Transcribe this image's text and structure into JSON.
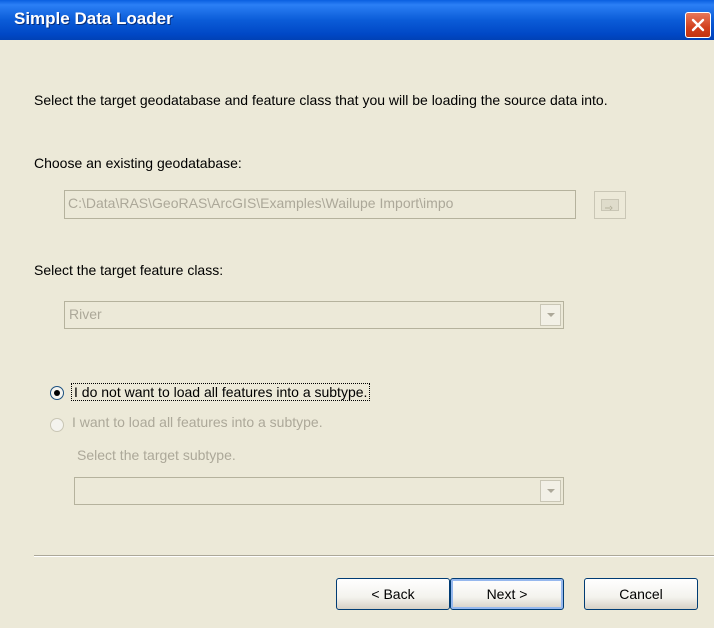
{
  "window": {
    "title": "Simple Data Loader"
  },
  "intro": "Select the target geodatabase and feature class that you will be loading the source data into.",
  "geodatabase": {
    "label": "Choose an existing geodatabase:",
    "path": "C:\\Data\\RAS\\GeoRAS\\ArcGIS\\Examples\\Wailupe Import\\impo"
  },
  "feature_class": {
    "label": "Select the target feature class:",
    "value": "River"
  },
  "subtype_options": {
    "option_no": "I do not want to load all features into a subtype.",
    "option_yes": "I want to load all features into a subtype.",
    "selected": "option_no",
    "target_label": "Select the target subtype.",
    "target_value": ""
  },
  "buttons": {
    "back_label": "< Back",
    "next_label": "Next >",
    "cancel_label": "Cancel"
  },
  "icons": {
    "close": "close-icon",
    "browse": "browse-folder-icon",
    "dropdown": "chevron-down-icon"
  },
  "colors": {
    "titlebar": "#0B5CD8",
    "background": "#ECE9D8",
    "disabled_text": "#ACA899",
    "close_button": "#D2401D"
  }
}
